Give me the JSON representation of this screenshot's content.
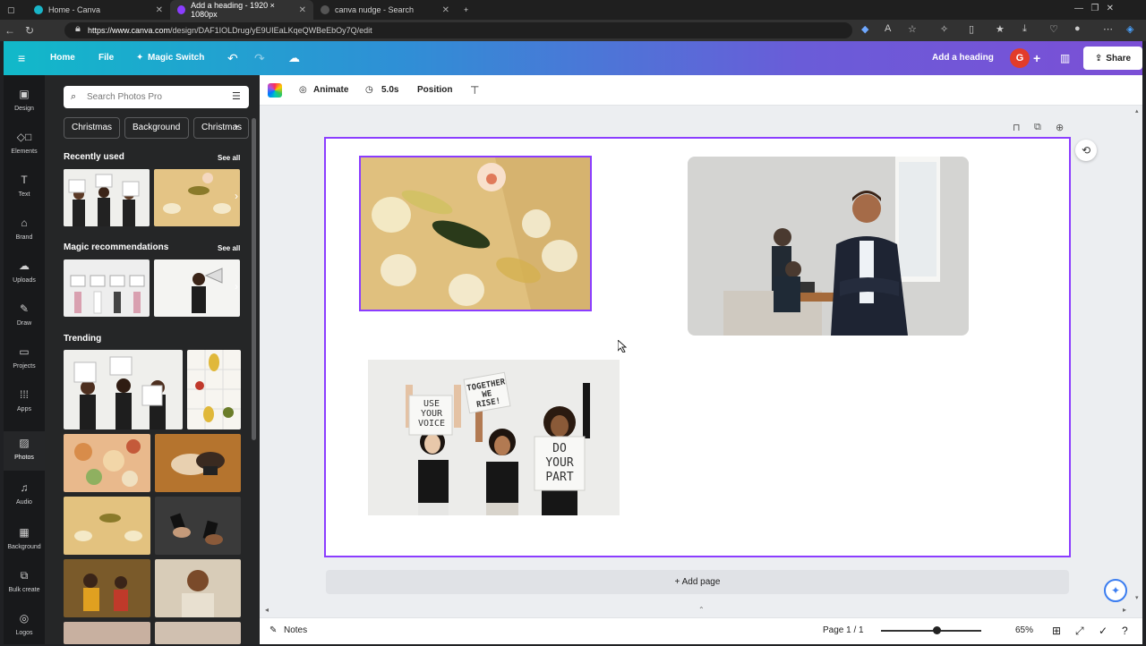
{
  "browser": {
    "tabs": [
      {
        "title": "Home - Canva"
      },
      {
        "title": "Add a heading - 1920 × 1080px"
      },
      {
        "title": "canva nudge - Search"
      }
    ],
    "url_host": "https://www.canva.com",
    "url_path": "/design/DAF1IOLDrug/yE9UIEaLKqeQWBeEbOy7Q/edit"
  },
  "topbar": {
    "home": "Home",
    "file": "File",
    "magic_switch": "Magic Switch",
    "design_title": "Add a heading",
    "avatar_letter": "G",
    "share": "Share"
  },
  "rail": [
    {
      "label": "Design",
      "icon": "layout-icon"
    },
    {
      "label": "Elements",
      "icon": "shapes-icon"
    },
    {
      "label": "Text",
      "icon": "text-icon"
    },
    {
      "label": "Brand",
      "icon": "brand-icon"
    },
    {
      "label": "Uploads",
      "icon": "cloud-upload-icon"
    },
    {
      "label": "Draw",
      "icon": "pen-icon"
    },
    {
      "label": "Projects",
      "icon": "folder-icon"
    },
    {
      "label": "Apps",
      "icon": "apps-grid-icon"
    },
    {
      "label": "Photos",
      "icon": "image-icon"
    },
    {
      "label": "Audio",
      "icon": "music-icon"
    },
    {
      "label": "Background",
      "icon": "pattern-icon"
    },
    {
      "label": "Bulk create",
      "icon": "bulk-icon"
    },
    {
      "label": "Logos",
      "icon": "logo-icon"
    }
  ],
  "panel": {
    "search_placeholder": "Search Photos Pro",
    "chips": [
      "Christmas",
      "Background",
      "Christmas"
    ],
    "recently_used": "Recently used",
    "magic_recommendations": "Magic recommendations",
    "trending": "Trending",
    "see_all": "See all"
  },
  "context_bar": {
    "animate": "Animate",
    "duration": "5.0s",
    "position": "Position"
  },
  "canvas": {
    "sign_use_your_voice": "USE YOUR VOICE",
    "sign_together_we_rise": "TOGETHER WE RISE!",
    "sign_do_your_part": "DO YOUR PART",
    "add_page": "+ Add page"
  },
  "bottom": {
    "notes": "Notes",
    "page_indicator": "Page 1 / 1",
    "zoom": "65%",
    "zoom_fraction": 0.55
  },
  "colors": {
    "accent": "#8b3dff",
    "topbar_start": "#11b9c9",
    "topbar_end": "#7b4fd6"
  }
}
